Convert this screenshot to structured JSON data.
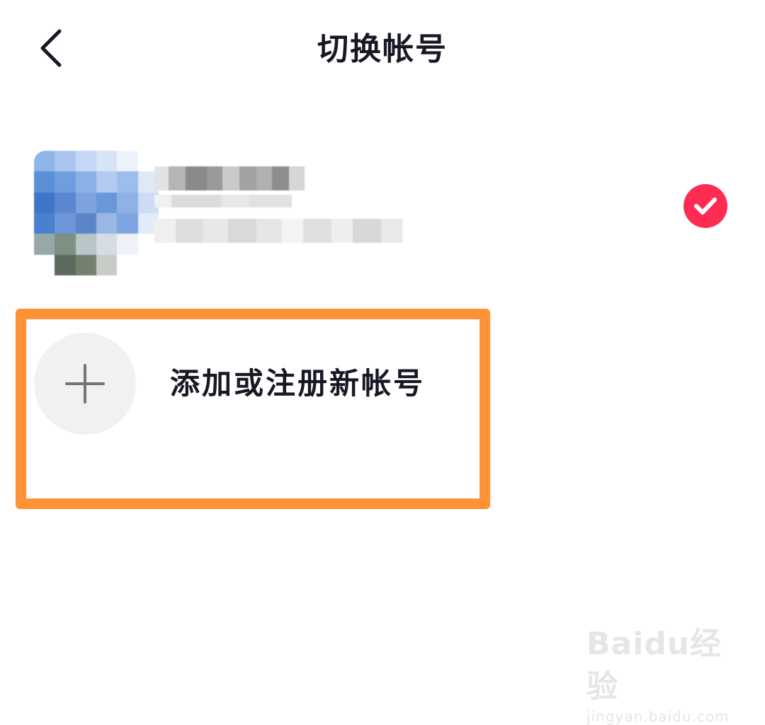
{
  "header": {
    "title": "切换帐号",
    "back_icon": "chevron-left-icon"
  },
  "current_account": {
    "selected": true,
    "check_icon": "check-circle-icon",
    "accent_color": "#fe2c55"
  },
  "add_account": {
    "label": "添加或注册新帐号",
    "icon": "plus-icon",
    "highlight_color": "#ff9136"
  },
  "watermark": {
    "logo": "Baidu经验",
    "url": "jingyan.baidu.com"
  }
}
